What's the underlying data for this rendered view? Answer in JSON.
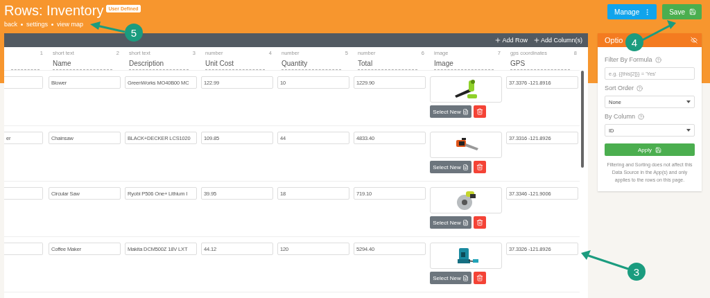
{
  "header": {
    "title": "Rows: Inventory",
    "badge": "User Defined",
    "links": [
      "back",
      "settings",
      "view map"
    ],
    "buttons": [
      {
        "kind": "manage",
        "label": "Manage"
      },
      {
        "kind": "save",
        "label": "Save"
      }
    ]
  },
  "table": {
    "toolbar": [
      "Add Row",
      "Add Column(s)"
    ],
    "columns": [
      {
        "number": "1"
      },
      {
        "type": "short text",
        "number": "2",
        "name": "Name"
      },
      {
        "type": "short text",
        "number": "3",
        "name": "Description"
      },
      {
        "type": "number",
        "number": "4",
        "name": "Unit Cost"
      },
      {
        "type": "number",
        "number": "5",
        "name": "Quantity"
      },
      {
        "type": "number",
        "number": "6",
        "name": "Total"
      },
      {
        "type": "image",
        "number": "7",
        "name": "Image"
      },
      {
        "type": "gps coordinates",
        "number": "8",
        "name": "GPS"
      }
    ],
    "rows": [
      {
        "cells": [
          {},
          {
            "value": "Blower"
          },
          {
            "value": "GreenWorks MO40B00 MC"
          },
          {
            "value": "122.99"
          },
          {
            "value": "10"
          },
          {
            "value": "1229.90"
          },
          {
            "kind": "picture",
            "button": "Select New"
          },
          {
            "value": "37.3376 -121.8916"
          }
        ]
      },
      {
        "cells": [
          {
            "value": "er"
          },
          {
            "value": "Chainsaw"
          },
          {
            "value": "BLACK+DECKER LCS1020"
          },
          {
            "value": "109.85"
          },
          {
            "value": "44"
          },
          {
            "value": "4833.40"
          },
          {
            "kind": "picture",
            "button": "Select New"
          },
          {
            "value": "37.3316 -121.8926"
          }
        ]
      },
      {
        "cells": [
          {},
          {
            "value": "Circular Saw"
          },
          {
            "value": "Ryobi P506 One+ Lithium I"
          },
          {
            "value": "39.95"
          },
          {
            "value": "18"
          },
          {
            "value": "719.10"
          },
          {
            "kind": "picture",
            "button": "Select New"
          },
          {
            "value": "37.3346 -121.9006"
          }
        ]
      },
      {
        "cells": [
          {},
          {
            "value": "Coffee Maker"
          },
          {
            "value": "Makita DCM500Z 18V LXT"
          },
          {
            "value": "44.12"
          },
          {
            "value": "120"
          },
          {
            "value": "5294.40"
          },
          {
            "kind": "picture",
            "button": "Select New"
          },
          {
            "value": "37.3326 -121.8926"
          }
        ]
      }
    ]
  },
  "options": {
    "title": "Optio",
    "filter": {
      "label": "Filter By Formula",
      "placeholder": "e.g. {{this[2]}} = 'Yes'"
    },
    "sort": {
      "label": "Sort Order",
      "value": "None"
    },
    "by_column": {
      "label": "By Column",
      "value": "ID"
    },
    "apply": "Apply",
    "note": "Filtering and Sorting does not affect this Data Source in the App(s) and only applies to the rows on this page."
  },
  "callouts": [
    {
      "number": "5"
    },
    {
      "number": "4"
    },
    {
      "number": "3"
    }
  ]
}
